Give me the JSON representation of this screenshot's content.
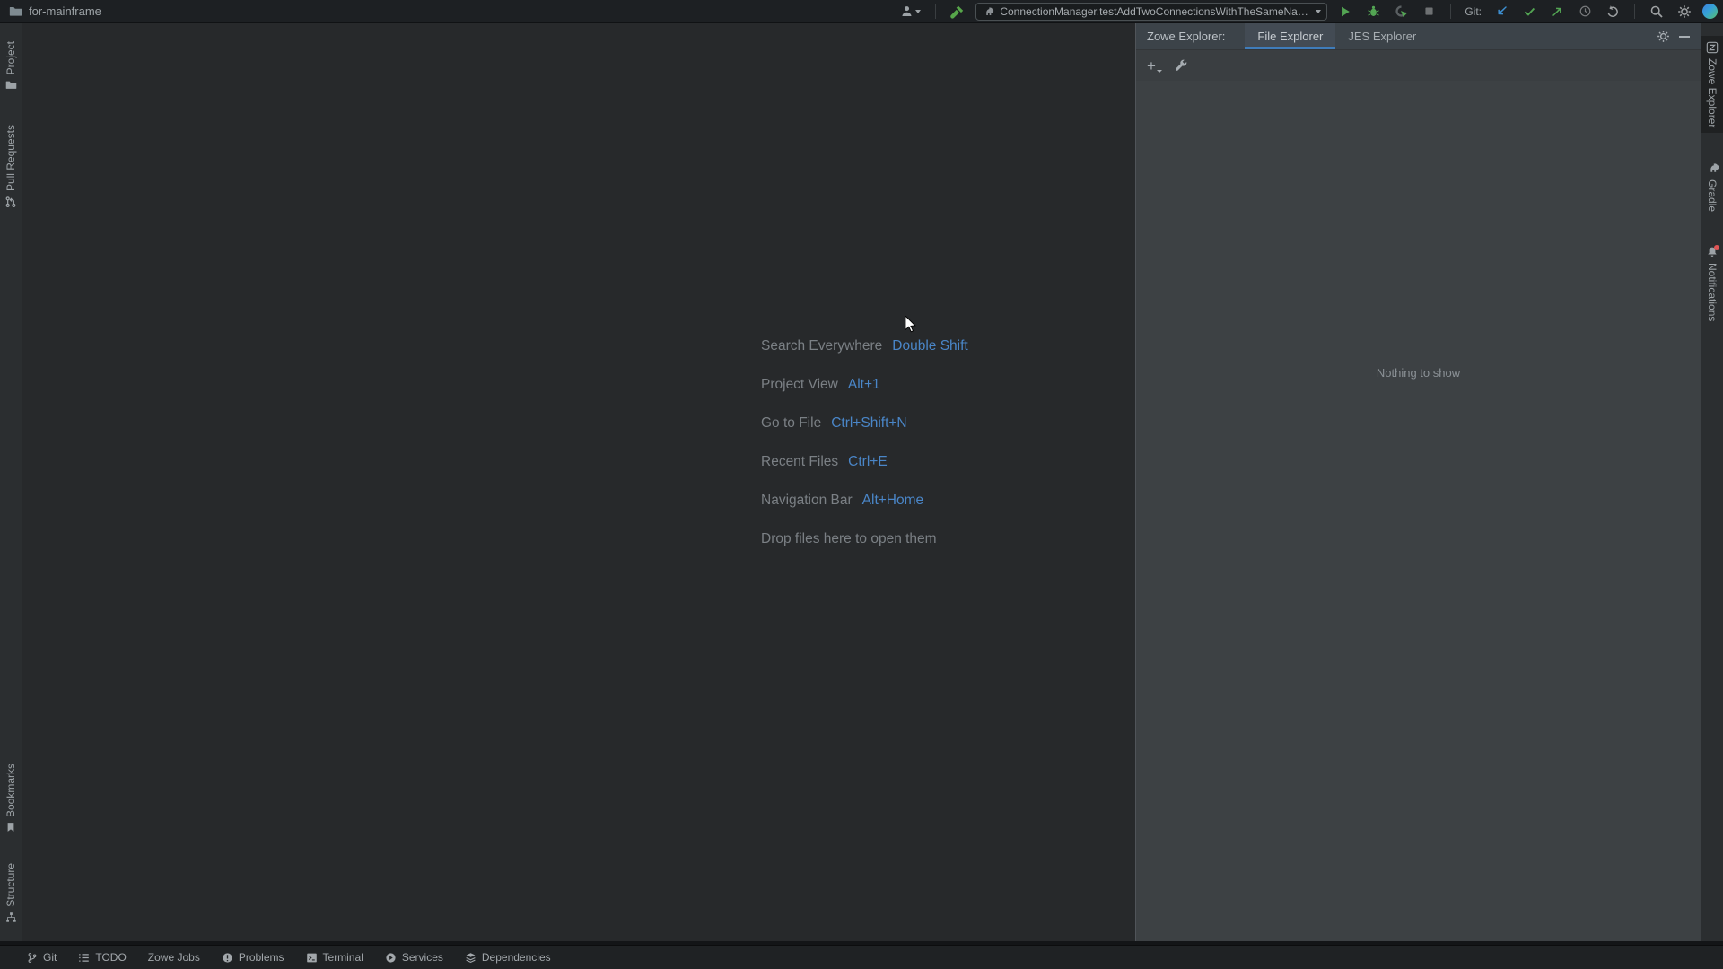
{
  "titlebar": {
    "project_name": "for-mainframe",
    "run_config": "ConnectionManager.testAddTwoConnectionsWithTheSameName",
    "git_label": "Git:"
  },
  "left_stripe": {
    "top_items": [
      {
        "label": "Project"
      },
      {
        "label": "Pull Requests"
      }
    ],
    "bottom_items": [
      {
        "label": "Bookmarks"
      },
      {
        "label": "Structure"
      }
    ]
  },
  "right_stripe": {
    "items": [
      {
        "label": "Zowe Explorer"
      },
      {
        "label": "Gradle"
      },
      {
        "label": "Notifications"
      }
    ]
  },
  "editor": {
    "shortcuts": [
      {
        "action": "Search Everywhere",
        "keys": "Double Shift"
      },
      {
        "action": "Project View",
        "keys": "Alt+1"
      },
      {
        "action": "Go to File",
        "keys": "Ctrl+Shift+N"
      },
      {
        "action": "Recent Files",
        "keys": "Ctrl+E"
      },
      {
        "action": "Navigation Bar",
        "keys": "Alt+Home"
      }
    ],
    "drop_hint": "Drop files here to open them"
  },
  "tool_window": {
    "title": "Zowe Explorer:",
    "tabs": [
      {
        "label": "File Explorer"
      },
      {
        "label": "JES Explorer"
      }
    ],
    "empty_text": "Nothing to show"
  },
  "statusbar": {
    "items": [
      {
        "label": "Git"
      },
      {
        "label": "TODO"
      },
      {
        "label": "Zowe Jobs"
      },
      {
        "label": "Problems"
      },
      {
        "label": "Terminal"
      },
      {
        "label": "Services"
      },
      {
        "label": "Dependencies"
      }
    ]
  },
  "colors": {
    "accent_blue": "#4a86c8",
    "run_green": "#53a553",
    "git_update_blue": "#3d8fd1",
    "tab_underline": "#3f7cba",
    "notification_badge": "#e05555"
  }
}
